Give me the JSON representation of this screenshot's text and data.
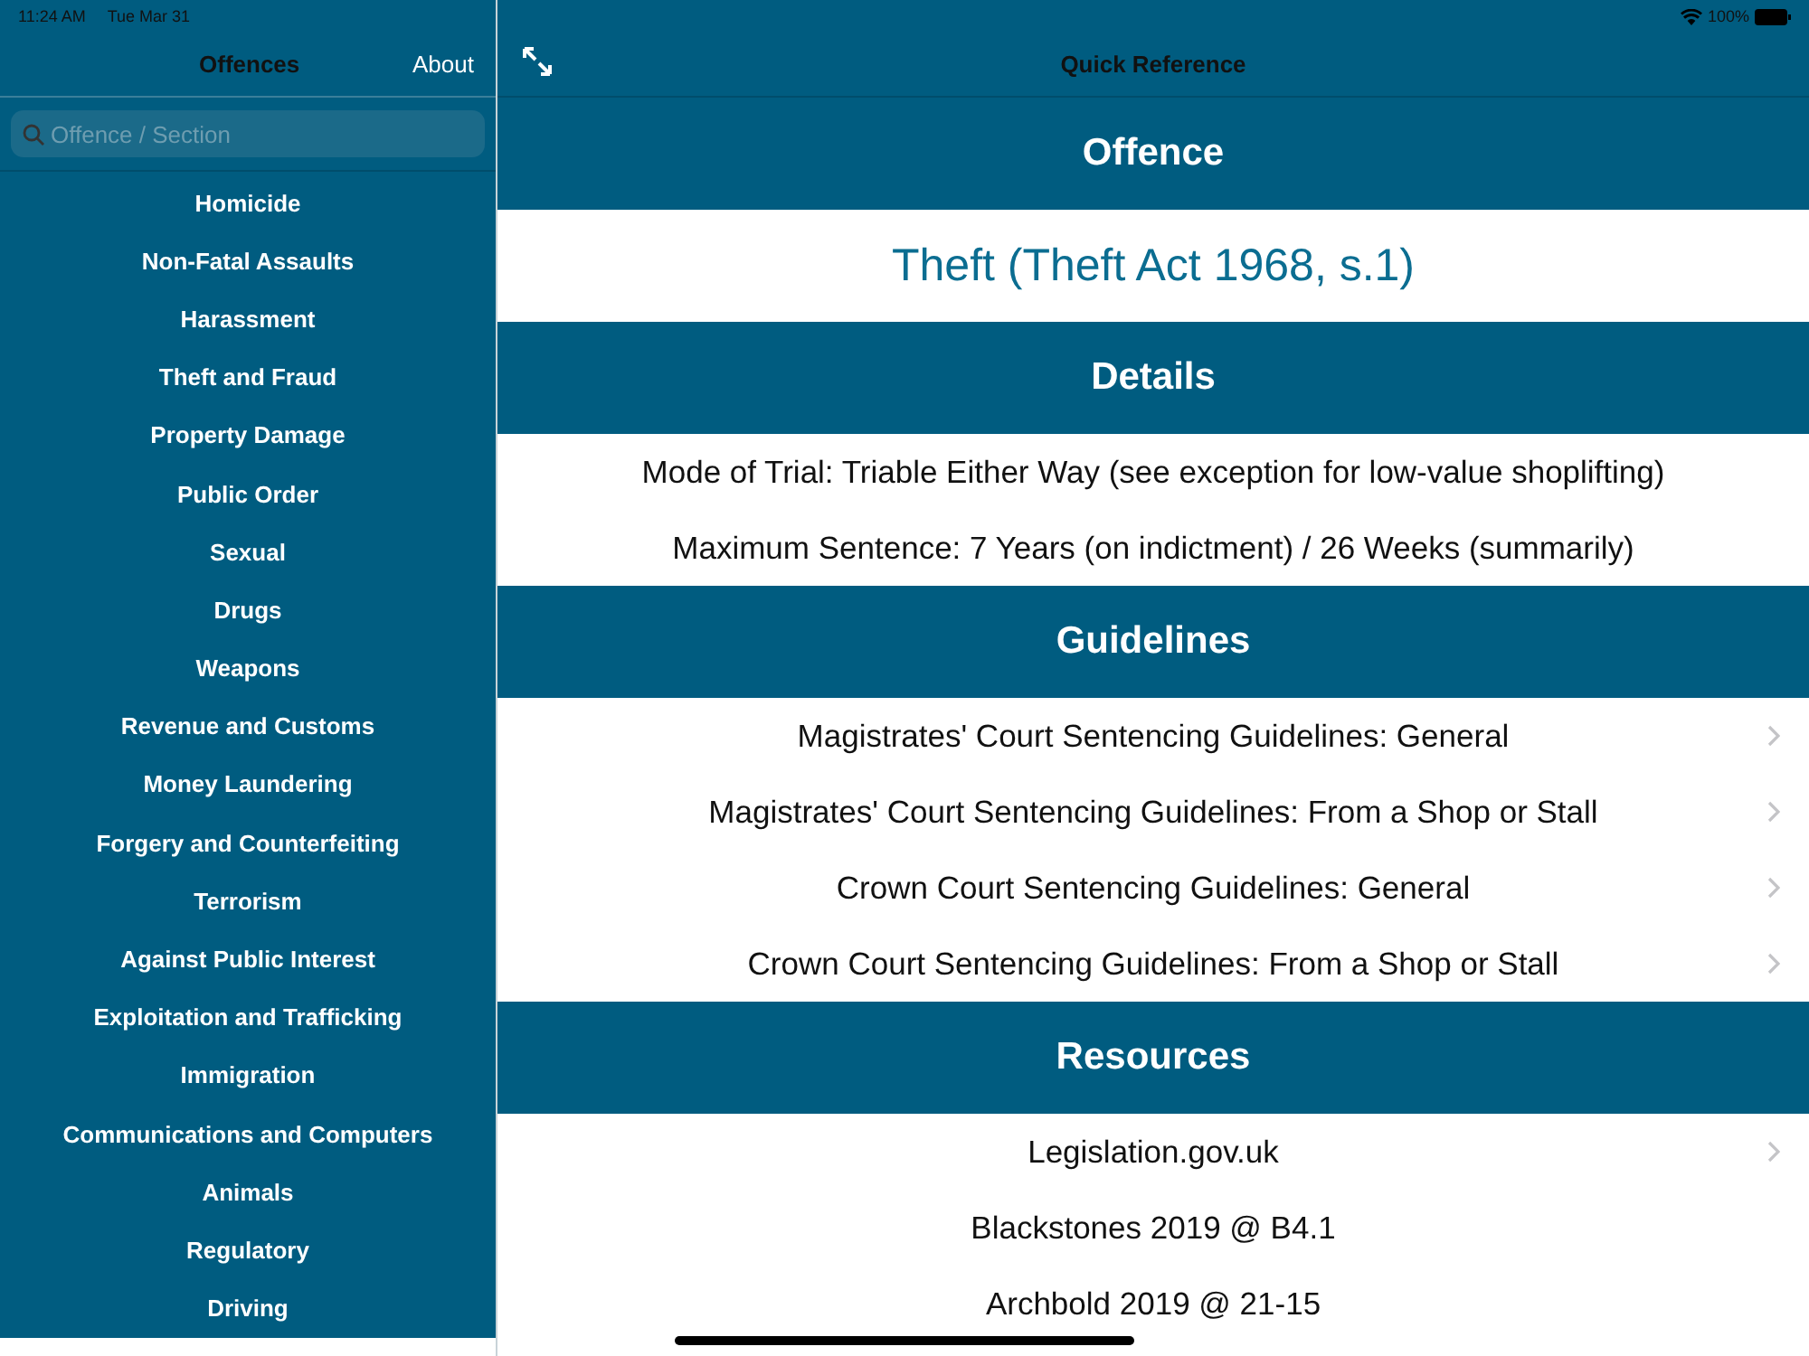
{
  "status_bar": {
    "time": "11:24 AM",
    "date": "Tue Mar 31",
    "battery": "100%"
  },
  "sidebar": {
    "title": "Offences",
    "about": "About",
    "search_placeholder": "Offence / Section",
    "items": [
      {
        "label": "Homicide"
      },
      {
        "label": "Non-Fatal Assaults"
      },
      {
        "label": "Harassment"
      },
      {
        "label": "Theft and Fraud"
      },
      {
        "label": "Property Damage"
      },
      {
        "label": "Public Order"
      },
      {
        "label": "Sexual"
      },
      {
        "label": "Drugs"
      },
      {
        "label": "Weapons"
      },
      {
        "label": "Revenue and Customs"
      },
      {
        "label": "Money Laundering"
      },
      {
        "label": "Forgery and Counterfeiting"
      },
      {
        "label": "Terrorism"
      },
      {
        "label": "Against Public Interest"
      },
      {
        "label": "Exploitation and Trafficking"
      },
      {
        "label": "Immigration"
      },
      {
        "label": "Communications and Computers"
      },
      {
        "label": "Animals"
      },
      {
        "label": "Regulatory"
      },
      {
        "label": "Driving"
      }
    ]
  },
  "main": {
    "title": "Quick Reference",
    "sections": [
      {
        "title": "Offence",
        "rows": [
          {
            "kind": "highlight",
            "text": "Theft (Theft Act 1968, s.1)",
            "link": false
          }
        ]
      },
      {
        "title": "Details",
        "rows": [
          {
            "kind": "plain",
            "text": "Mode of Trial: Triable Either Way (see exception for low-value shoplifting)",
            "link": false
          },
          {
            "kind": "plain",
            "text": "Maximum Sentence: 7 Years (on indictment) / 26 Weeks (summarily)",
            "link": false
          }
        ]
      },
      {
        "title": "Guidelines",
        "rows": [
          {
            "kind": "plain",
            "text": "Magistrates' Court Sentencing Guidelines: General",
            "link": true
          },
          {
            "kind": "plain",
            "text": "Magistrates' Court Sentencing Guidelines: From a Shop or Stall",
            "link": true
          },
          {
            "kind": "plain",
            "text": "Crown Court Sentencing Guidelines: General",
            "link": true
          },
          {
            "kind": "plain",
            "text": "Crown Court Sentencing Guidelines: From a Shop or Stall",
            "link": true
          }
        ]
      },
      {
        "title": "Resources",
        "rows": [
          {
            "kind": "plain",
            "text": "Legislation.gov.uk",
            "link": true
          },
          {
            "kind": "plain",
            "text": "Blackstones 2019 @ B4.1",
            "link": false
          },
          {
            "kind": "plain",
            "text": "Archbold 2019 @ 21-15",
            "link": false
          }
        ]
      }
    ]
  }
}
